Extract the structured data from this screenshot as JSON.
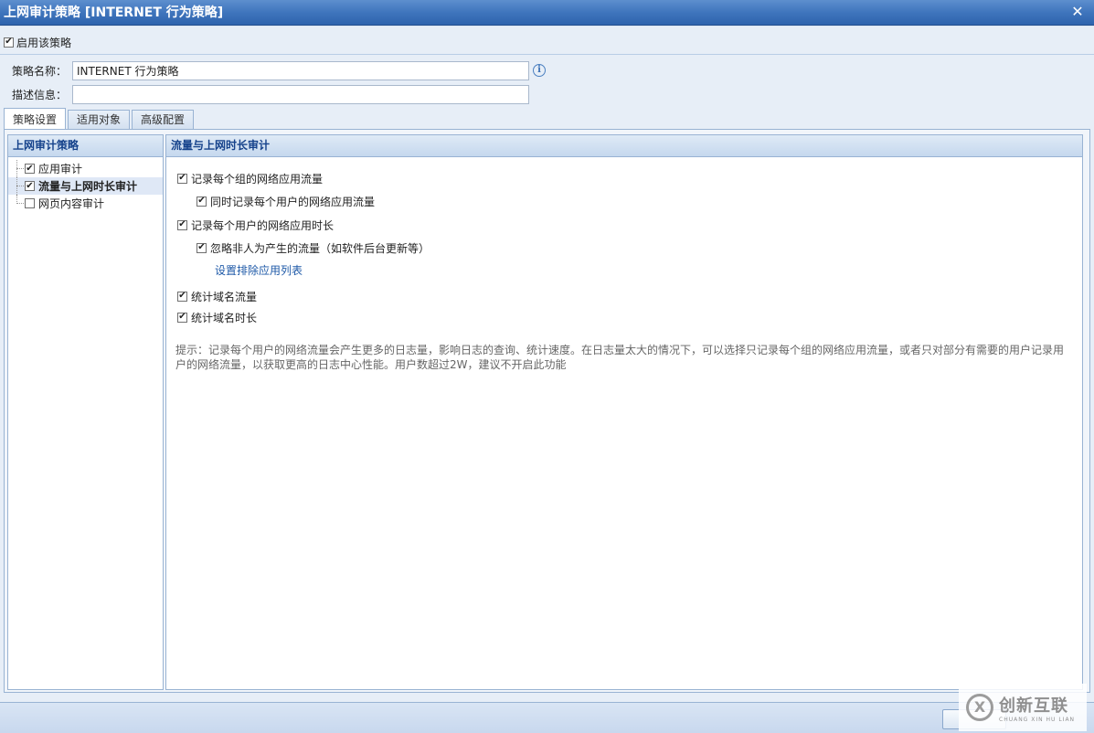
{
  "window": {
    "title": "上网审计策略 [INTERNET 行为策略]",
    "close_glyph": "✕"
  },
  "enable": {
    "label": "启用该策略",
    "checked": true
  },
  "form": {
    "name_label": "策略名称：",
    "name_value": "INTERNET 行为策略",
    "desc_label": "描述信息：",
    "desc_value": ""
  },
  "tabs": [
    {
      "label": "策略设置",
      "active": true
    },
    {
      "label": "适用对象",
      "active": false
    },
    {
      "label": "高级配置",
      "active": false
    }
  ],
  "left_panel": {
    "title": "上网审计策略",
    "items": [
      {
        "label": "应用审计",
        "checked": true,
        "selected": false
      },
      {
        "label": "流量与上网时长审计",
        "checked": true,
        "selected": true
      },
      {
        "label": "网页内容审计",
        "checked": false,
        "selected": false
      }
    ]
  },
  "right_panel": {
    "title": "流量与上网时长审计",
    "options": {
      "record_group_traffic": "记录每个组的网络应用流量",
      "record_user_traffic": "同时记录每个用户的网络应用流量",
      "record_user_duration": "记录每个用户的网络应用时长",
      "ignore_background": "忽略非人为产生的流量（如软件后台更新等）",
      "exclude_list_link": "设置排除应用列表",
      "domain_traffic": "统计域名流量",
      "domain_duration": "统计域名时长"
    },
    "tip": "提示：记录每个用户的网络流量会产生更多的日志量，影响日志的查询、统计速度。在日志量太大的情况下，可以选择只记录每个组的网络应用流量，或者只对部分有需要的用户记录用户的网络流量，以获取更高的日志中心性能。用户数超过2W，建议不开启此功能"
  },
  "watermark": {
    "logo": "创新互联",
    "sub": "CHUANG XIN HU LIAN"
  },
  "icons": {
    "check": "✔",
    "info": "i",
    "close": "close-icon",
    "watermark_symbol": "X"
  }
}
